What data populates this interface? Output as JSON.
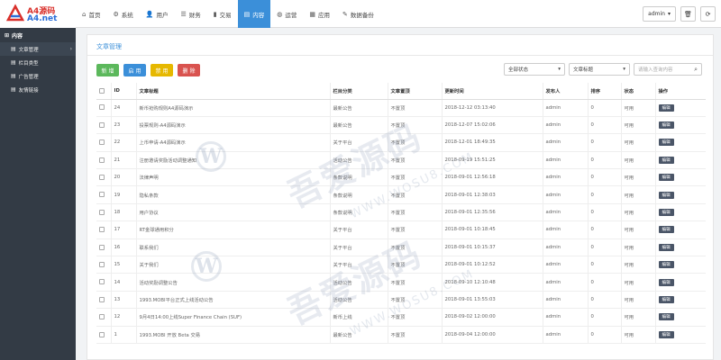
{
  "brand": {
    "line1": "A4源码",
    "line2": "A4.net"
  },
  "nav": [
    {
      "icon": "home-icon",
      "glyph": "⌂",
      "label": "首页"
    },
    {
      "icon": "gear-icon",
      "glyph": "⚙",
      "label": "系统"
    },
    {
      "icon": "user-icon",
      "glyph": "👤",
      "label": "用户"
    },
    {
      "icon": "list-icon",
      "glyph": "☰",
      "label": "财务"
    },
    {
      "icon": "bar-chart-icon",
      "glyph": "▮",
      "label": "交易"
    },
    {
      "icon": "document-icon",
      "glyph": "▤",
      "label": "内容"
    },
    {
      "icon": "globe-icon",
      "glyph": "◍",
      "label": "运营"
    },
    {
      "icon": "grid-icon",
      "glyph": "▦",
      "label": "应用"
    },
    {
      "icon": "wrench-icon",
      "glyph": "✎",
      "label": "数据备份"
    }
  ],
  "nav_active_index": 5,
  "user": {
    "name": "admin",
    "caret": "▾"
  },
  "top_icons": {
    "trash": "🗑",
    "refresh": "⟳"
  },
  "sidebar": {
    "header": "内容",
    "items": [
      {
        "label": "文章管理",
        "active": true
      },
      {
        "label": "栏目类型",
        "active": false
      },
      {
        "label": "广告管理",
        "active": false
      },
      {
        "label": "友情链接",
        "active": false
      }
    ]
  },
  "page_title": "文章管理",
  "actions": {
    "add": "新 增",
    "enable": "启 用",
    "disable": "禁 用",
    "delete": "删 除"
  },
  "filters": {
    "status": "全部状态",
    "field": "文章标题",
    "search_placeholder": "请输入查询内容"
  },
  "table": {
    "headers": [
      "ID",
      "文章标题",
      "栏目分类",
      "文章置顶",
      "更新时间",
      "发布人",
      "排序",
      "状态",
      "操作"
    ],
    "edit_label": "编辑",
    "rows": [
      {
        "id": "24",
        "title": "新币抢购规则A4源码演示",
        "category": "最新公告",
        "pinned": "不置顶",
        "updated": "2018-12-12 03:13:40",
        "author": "admin",
        "sort": "0",
        "status": "可用"
      },
      {
        "id": "23",
        "title": "投票规则-A4源码演示",
        "category": "最新公告",
        "pinned": "不置顶",
        "updated": "2018-12-07 15:02:06",
        "author": "admin",
        "sort": "0",
        "status": "可用"
      },
      {
        "id": "22",
        "title": "上币申请-A4源码演示",
        "category": "关于平台",
        "pinned": "不置顶",
        "updated": "2018-12-01 18:49:35",
        "author": "admin",
        "sort": "0",
        "status": "可用"
      },
      {
        "id": "21",
        "title": "注册邀请奖励活动调整通知",
        "category": "活动公告",
        "pinned": "不置顶",
        "updated": "2018-09-19 15:51:25",
        "author": "admin",
        "sort": "0",
        "status": "可用"
      },
      {
        "id": "20",
        "title": "法律声明",
        "category": "条款说明",
        "pinned": "不置顶",
        "updated": "2018-09-01 12:56:18",
        "author": "admin",
        "sort": "0",
        "status": "可用"
      },
      {
        "id": "19",
        "title": "隐私条款",
        "category": "条款说明",
        "pinned": "不置顶",
        "updated": "2018-09-01 12:38:03",
        "author": "admin",
        "sort": "0",
        "status": "可用"
      },
      {
        "id": "18",
        "title": "用户协议",
        "category": "条款说明",
        "pinned": "不置顶",
        "updated": "2018-09-01 12:35:56",
        "author": "admin",
        "sort": "0",
        "status": "可用"
      },
      {
        "id": "17",
        "title": "RT金球通用积分",
        "category": "关于平台",
        "pinned": "不置顶",
        "updated": "2018-09-01 10:18:45",
        "author": "admin",
        "sort": "0",
        "status": "可用"
      },
      {
        "id": "16",
        "title": "联系我们",
        "category": "关于平台",
        "pinned": "不置顶",
        "updated": "2018-09-01 10:15:37",
        "author": "admin",
        "sort": "0",
        "status": "可用"
      },
      {
        "id": "15",
        "title": "关于我们",
        "category": "关于平台",
        "pinned": "不置顶",
        "updated": "2018-09-01 10:12:52",
        "author": "admin",
        "sort": "0",
        "status": "可用"
      },
      {
        "id": "14",
        "title": "活动奖励调整公告",
        "category": "活动公告",
        "pinned": "不置顶",
        "updated": "2018-09-10 12:10:48",
        "author": "admin",
        "sort": "0",
        "status": "可用"
      },
      {
        "id": "13",
        "title": "1993.MOBI平台正式上线活动公告",
        "category": "活动公告",
        "pinned": "不置顶",
        "updated": "2018-09-01 13:55:03",
        "author": "admin",
        "sort": "0",
        "status": "可用"
      },
      {
        "id": "12",
        "title": "9月4日14:00上线Super Finance Chain (SUF)",
        "category": "新币上线",
        "pinned": "不置顶",
        "updated": "2018-09-02 12:00:00",
        "author": "admin",
        "sort": "0",
        "status": "可用"
      },
      {
        "id": "1",
        "title": "1993.MOBI 开放 Beta 交易",
        "category": "最新公告",
        "pinned": "不置顶",
        "updated": "2018-09-04 12:00:00",
        "author": "admin",
        "sort": "0",
        "status": "可用"
      }
    ]
  },
  "watermark": {
    "text": "吾爱源码",
    "sub": "WWW.WOSU8.COM",
    "mark": "W"
  }
}
